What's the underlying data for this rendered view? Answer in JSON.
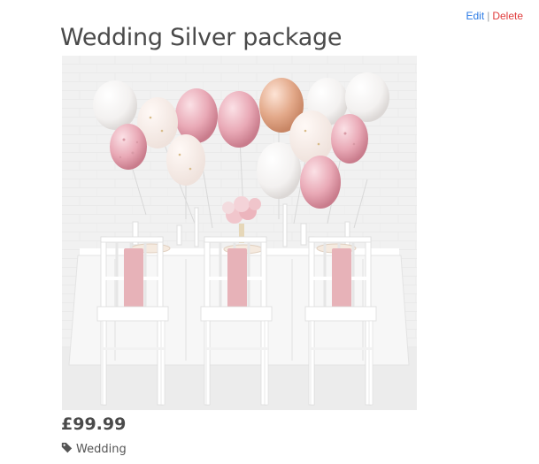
{
  "admin": {
    "edit_label": "Edit",
    "separator": "|",
    "delete_label": "Delete"
  },
  "product": {
    "title": "Wedding Silver package",
    "price": "£99.99",
    "category": "Wedding",
    "category_icon": "tag-icon",
    "image_alt": "Wedding table with white chairs, pink napkins and balloons"
  },
  "colors": {
    "edit": "#2c7be5",
    "delete": "#e03b3b",
    "text": "#4a4a4a"
  }
}
